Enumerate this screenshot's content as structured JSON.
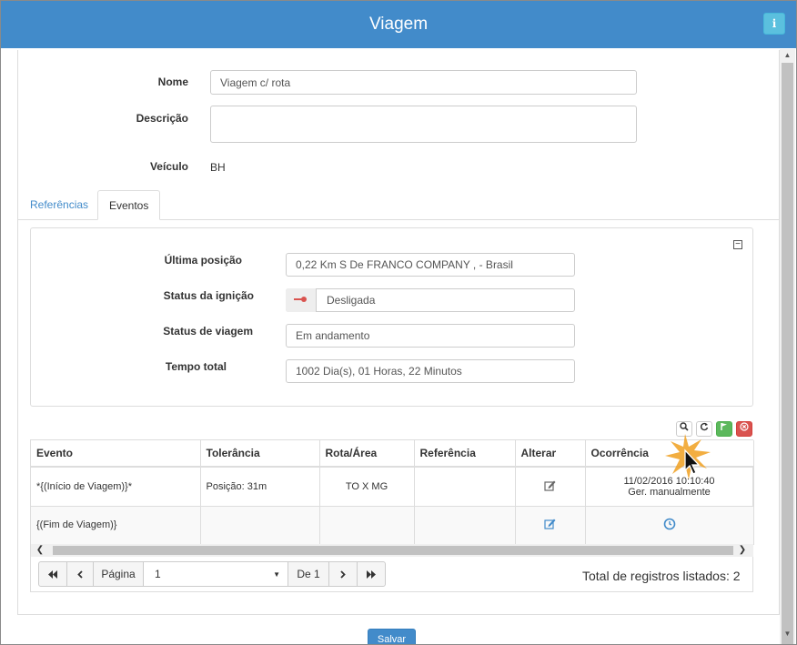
{
  "window": {
    "title": "Viagem",
    "info_label": "i"
  },
  "form": {
    "nome_label": "Nome",
    "nome_value": "Viagem c/ rota",
    "descricao_label": "Descrição",
    "descricao_value": "",
    "veiculo_label": "Veículo",
    "veiculo_value": "BH"
  },
  "tabs": [
    {
      "label": "Referências",
      "active": false
    },
    {
      "label": "Eventos",
      "active": true
    }
  ],
  "status": {
    "ultima_posicao_label": "Última posição",
    "ultima_posicao_value": "0,22 Km S De FRANCO COMPANY , - Brasil",
    "ignicao_label": "Status da ignição",
    "ignicao_value": "Desligada",
    "viagem_label": "Status de viagem",
    "viagem_value": "Em andamento",
    "tempo_label": "Tempo total",
    "tempo_value": "1002 Dia(s), 01 Horas, 22 Minutos"
  },
  "table": {
    "headers": [
      "Evento",
      "Tolerância",
      "Rota/Área",
      "Referência",
      "Alterar",
      "Ocorrência"
    ],
    "rows": [
      {
        "evento": "*{(Início de Viagem)}*",
        "tolerancia": "Posição: 31m",
        "rota": "TO X MG",
        "referencia": "",
        "ocorrencia_date": "11/02/2016 10:10:40",
        "ocorrencia_note": "Ger. manualmente"
      },
      {
        "evento": "{(Fim de Viagem)}",
        "tolerancia": "",
        "rota": "",
        "referencia": "",
        "ocorrencia_date": "",
        "ocorrencia_note": ""
      }
    ]
  },
  "pager": {
    "page_label": "Página",
    "page_value": "1",
    "of_label": "De 1",
    "total_label": "Total de registros listados: 2"
  },
  "footer": {
    "save_label": "Salvar"
  },
  "colors": {
    "primary": "#428bca",
    "info": "#5bc0de",
    "success": "#5cb85c",
    "danger": "#d9534f",
    "ignition_off": "#d9534f"
  }
}
